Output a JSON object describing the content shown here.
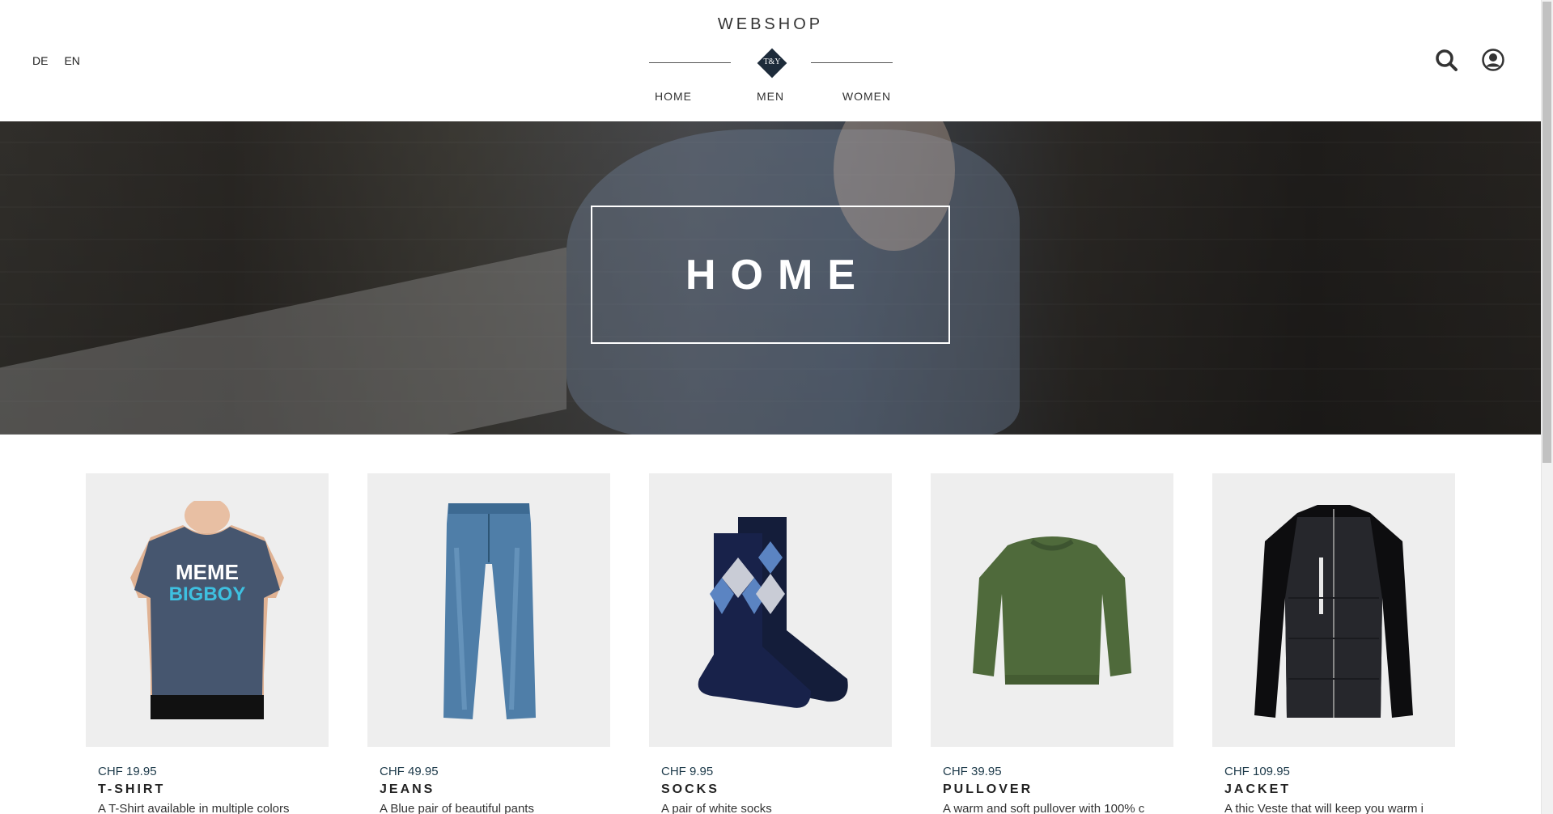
{
  "header": {
    "languages": [
      "DE",
      "EN"
    ],
    "brand": "WEBSHOP",
    "logo_text": "T&Y",
    "nav": [
      "HOME",
      "MEN",
      "WOMEN"
    ]
  },
  "hero": {
    "title": "HOME"
  },
  "products": [
    {
      "price": "CHF 19.95",
      "name": "T-SHIRT",
      "description": "A T-Shirt available in multiple colors",
      "shirt_text_1": "MEME",
      "shirt_text_2": "BIGBOY"
    },
    {
      "price": "CHF 49.95",
      "name": "JEANS",
      "description": "A Blue pair of beautiful pants"
    },
    {
      "price": "CHF 9.95",
      "name": "SOCKS",
      "description": "A pair of white socks"
    },
    {
      "price": "CHF 39.95",
      "name": "PULLOVER",
      "description": "A warm and soft pullover with 100% c"
    },
    {
      "price": "CHF 109.95",
      "name": "JACKET",
      "description": "A thic Veste that will keep you warm i"
    }
  ],
  "colors": {
    "logo": "#1d2b3a",
    "price": "#1d3a4a",
    "card_bg": "#eeeeee"
  },
  "icons": [
    "search-icon",
    "user-account-icon"
  ]
}
